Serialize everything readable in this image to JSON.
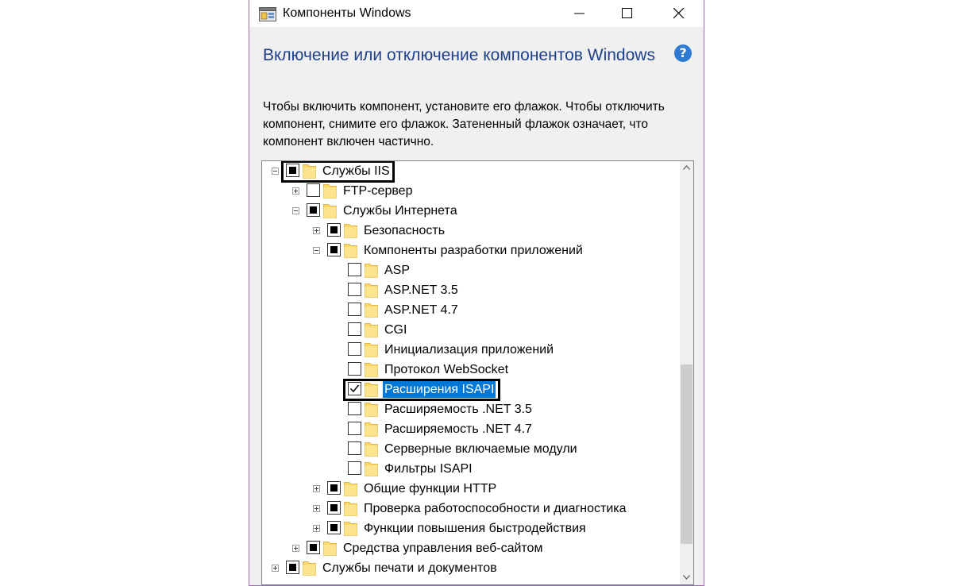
{
  "window": {
    "title": "Компоненты Windows",
    "accent_color": "#a463c9",
    "controls": {
      "minimize": "minimize-icon",
      "maximize": "maximize-icon",
      "close": "close-icon"
    }
  },
  "heading": "Включение или отключение компонентов Windows",
  "help_icon": {
    "name": "help-icon",
    "glyph": "?"
  },
  "description": "Чтобы включить компонент, установите его флажок. Чтобы отключить компонент, снимите его флажок. Затененный флажок означает, что компонент включен частично.",
  "tree": [
    {
      "label": "Службы IIS",
      "level": 0,
      "expander": "minus",
      "state": "partial",
      "highlighted": true
    },
    {
      "label": "FTP-сервер",
      "level": 1,
      "expander": "plus",
      "state": "unchecked"
    },
    {
      "label": "Службы Интернета",
      "level": 1,
      "expander": "minus",
      "state": "partial"
    },
    {
      "label": "Безопасность",
      "level": 2,
      "expander": "plus",
      "state": "partial"
    },
    {
      "label": "Компоненты разработки приложений",
      "level": 2,
      "expander": "minus",
      "state": "partial"
    },
    {
      "label": "ASP",
      "level": 3,
      "expander": "none",
      "state": "unchecked"
    },
    {
      "label": "ASP.NET 3.5",
      "level": 3,
      "expander": "none",
      "state": "unchecked"
    },
    {
      "label": "ASP.NET 4.7",
      "level": 3,
      "expander": "none",
      "state": "unchecked"
    },
    {
      "label": "CGI",
      "level": 3,
      "expander": "none",
      "state": "unchecked"
    },
    {
      "label": "Инициализация приложений",
      "level": 3,
      "expander": "none",
      "state": "unchecked"
    },
    {
      "label": "Протокол WebSocket",
      "level": 3,
      "expander": "none",
      "state": "unchecked"
    },
    {
      "label": "Расширения ISAPI",
      "level": 3,
      "expander": "none",
      "state": "checked",
      "selected": true,
      "highlighted": true
    },
    {
      "label": "Расширяемость .NET 3.5",
      "level": 3,
      "expander": "none",
      "state": "unchecked"
    },
    {
      "label": "Расширяемость .NET 4.7",
      "level": 3,
      "expander": "none",
      "state": "unchecked"
    },
    {
      "label": "Серверные включаемые модули",
      "level": 3,
      "expander": "none",
      "state": "unchecked"
    },
    {
      "label": "Фильтры ISAPI",
      "level": 3,
      "expander": "none",
      "state": "unchecked"
    },
    {
      "label": "Общие функции HTTP",
      "level": 2,
      "expander": "plus",
      "state": "partial"
    },
    {
      "label": "Проверка работоспособности и диагностика",
      "level": 2,
      "expander": "plus",
      "state": "partial"
    },
    {
      "label": "Функции повышения быстродействия",
      "level": 2,
      "expander": "plus",
      "state": "partial"
    },
    {
      "label": "Средства управления веб-сайтом",
      "level": 1,
      "expander": "plus",
      "state": "partial"
    },
    {
      "label": "Службы печати и документов",
      "level": 0,
      "expander": "plus",
      "state": "partial"
    }
  ],
  "colors": {
    "heading": "#1e3f8a",
    "selection": "#0078d7",
    "folder": "#ffd86a",
    "help": "#2f7bd1"
  }
}
